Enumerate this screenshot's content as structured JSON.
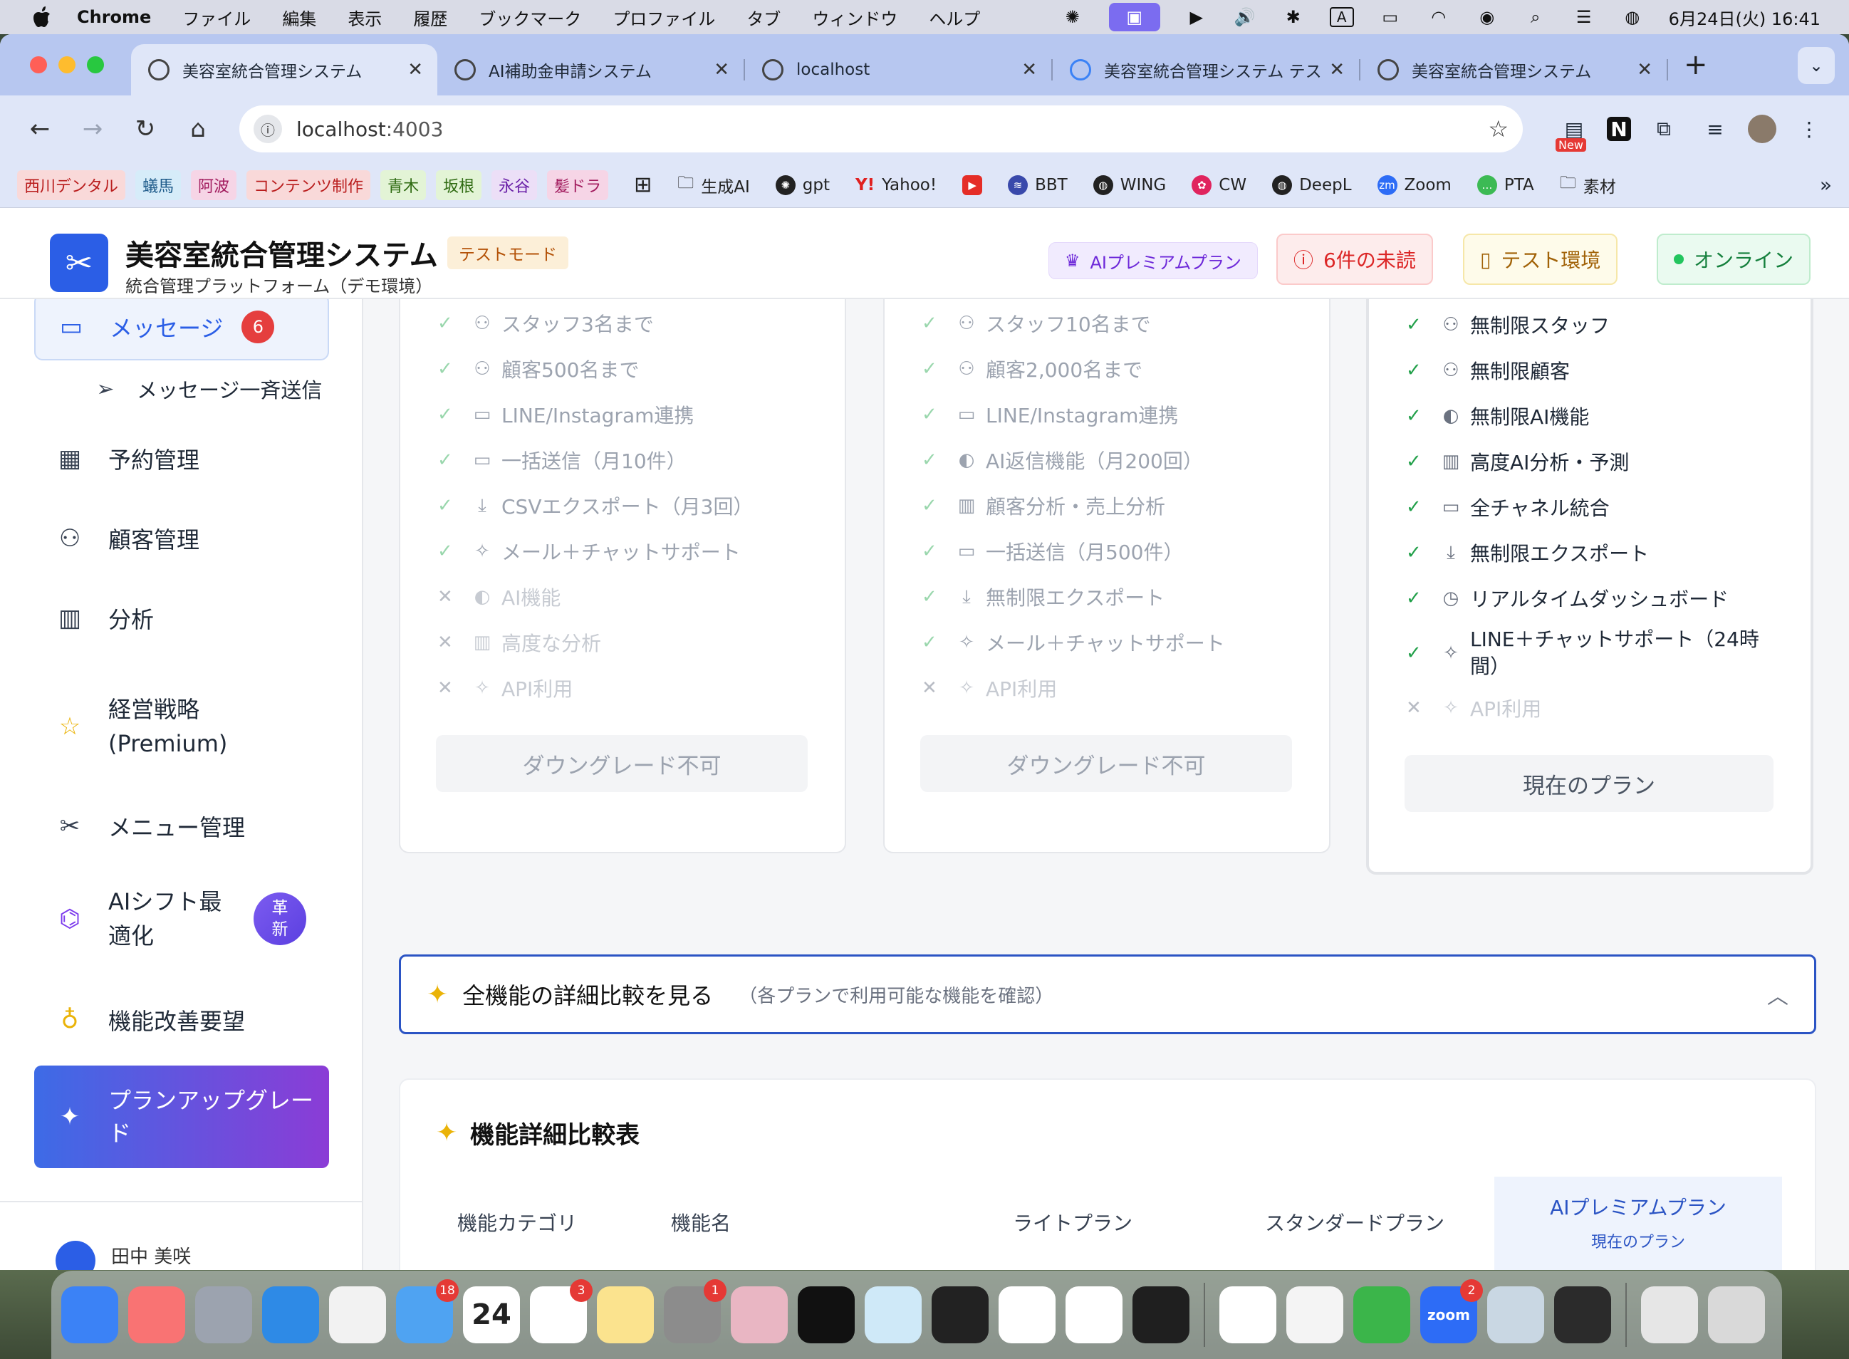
{
  "menubar": {
    "app_name": "Chrome",
    "menus": [
      "ファイル",
      "編集",
      "表示",
      "履歴",
      "ブックマーク",
      "プロファイル",
      "タブ",
      "ウィンドウ",
      "ヘルプ"
    ],
    "clock": "6月24日(火) 16:41",
    "input_indicator": "A"
  },
  "browser": {
    "tabs": [
      {
        "title": "美容室統合管理システム",
        "active": true
      },
      {
        "title": "AI補助金申請システム",
        "active": false
      },
      {
        "title": "localhost",
        "active": false
      },
      {
        "title": "美容室統合管理システム テス",
        "active": false
      },
      {
        "title": "美容室統合管理システム",
        "active": false
      }
    ],
    "url_host": "localhost",
    "url_port": ":4003",
    "bookmark_tags": [
      {
        "label": "西川デンタル",
        "bg": "#f9d9d9",
        "fg": "#b91c1c"
      },
      {
        "label": "蟻馬",
        "bg": "#d6ecf9",
        "fg": "#1e5b8a"
      },
      {
        "label": "阿波",
        "bg": "#f6d5e6",
        "fg": "#a21c5e"
      },
      {
        "label": "コンテンツ制作",
        "bg": "#f9d9d9",
        "fg": "#b91c1c"
      },
      {
        "label": "青木",
        "bg": "#e3f4d6",
        "fg": "#2f6b12"
      },
      {
        "label": "坂根",
        "bg": "#e3f4d6",
        "fg": "#2f6b12"
      },
      {
        "label": "永谷",
        "bg": "#ecdff7",
        "fg": "#6b21a8"
      },
      {
        "label": "髪ドラ",
        "bg": "#f6d5e6",
        "fg": "#a21c5e"
      }
    ],
    "bookmarks": [
      "生成AI",
      "gpt",
      "Yahoo!",
      "BBT",
      "WING",
      "CW",
      "DeepL",
      "Zoom",
      "PTA",
      "素材"
    ],
    "new_label": "New"
  },
  "app": {
    "title": "美容室統合管理システム",
    "subtitle": "統合管理プラットフォーム（デモ環境）",
    "test_mode": "テストモード",
    "header": {
      "premium": "AIプレミアムプラン",
      "unread": "6件の未読",
      "test_env": "テスト環境",
      "online": "オンライン"
    },
    "sidebar": {
      "messages": "メッセージ",
      "messages_count": "6",
      "broadcast": "メッセージ一斉送信",
      "reservations": "予約管理",
      "customers": "顧客管理",
      "analytics": "分析",
      "strategy_line1": "経営戦略",
      "strategy_line2": "(Premium)",
      "menu": "メニュー管理",
      "shift_line1": "AIシフト最",
      "shift_line2": "適化",
      "shift_badge_line1": "革",
      "shift_badge_line2": "新",
      "requests": "機能改善要望",
      "upgrade_line1": "プランアップグレー",
      "upgrade_line2": "ド",
      "user": "田中 美咲"
    },
    "plans": [
      {
        "features": [
          {
            "text": "スタッフ3名まで",
            "ok": true,
            "icon": "users"
          },
          {
            "text": "顧客500名まで",
            "ok": true,
            "icon": "users"
          },
          {
            "text": "LINE/Instagram連携",
            "ok": true,
            "icon": "chat"
          },
          {
            "text": "一括送信（月10件）",
            "ok": true,
            "icon": "chat"
          },
          {
            "text": "CSVエクスポート（月3回）",
            "ok": true,
            "icon": "download"
          },
          {
            "text": "メール＋チャットサポート",
            "ok": true,
            "icon": "sparkle"
          },
          {
            "text": "AI機能",
            "ok": false,
            "icon": "brain"
          },
          {
            "text": "高度な分析",
            "ok": false,
            "icon": "chart"
          },
          {
            "text": "API利用",
            "ok": false,
            "icon": "sparkle"
          }
        ],
        "button": "ダウングレード不可"
      },
      {
        "features": [
          {
            "text": "スタッフ10名まで",
            "ok": true,
            "icon": "users"
          },
          {
            "text": "顧客2,000名まで",
            "ok": true,
            "icon": "users"
          },
          {
            "text": "LINE/Instagram連携",
            "ok": true,
            "icon": "chat"
          },
          {
            "text": "AI返信機能（月200回）",
            "ok": true,
            "icon": "brain"
          },
          {
            "text": "顧客分析・売上分析",
            "ok": true,
            "icon": "chart"
          },
          {
            "text": "一括送信（月500件）",
            "ok": true,
            "icon": "chat"
          },
          {
            "text": "無制限エクスポート",
            "ok": true,
            "icon": "download"
          },
          {
            "text": "メール＋チャットサポート",
            "ok": true,
            "icon": "sparkle"
          },
          {
            "text": "API利用",
            "ok": false,
            "icon": "sparkle"
          }
        ],
        "button": "ダウングレード不可"
      },
      {
        "features": [
          {
            "text": "無制限スタッフ",
            "ok": true,
            "icon": "users"
          },
          {
            "text": "無制限顧客",
            "ok": true,
            "icon": "users"
          },
          {
            "text": "無制限AI機能",
            "ok": true,
            "icon": "brain"
          },
          {
            "text": "高度AI分析・予測",
            "ok": true,
            "icon": "chart"
          },
          {
            "text": "全チャネル統合",
            "ok": true,
            "icon": "chat"
          },
          {
            "text": "無制限エクスポート",
            "ok": true,
            "icon": "download"
          },
          {
            "text": "リアルタイムダッシュボード",
            "ok": true,
            "icon": "clock"
          },
          {
            "text": "LINE＋チャットサポート（24時間）",
            "ok": true,
            "icon": "sparkle"
          },
          {
            "text": "API利用",
            "ok": false,
            "icon": "sparkle"
          }
        ],
        "button": "現在のプラン"
      }
    ],
    "compare_toggle": {
      "title": "全機能の詳細比較を見る",
      "subtitle": "（各プランで利用可能な機能を確認）"
    },
    "compare_table": {
      "title": "機能詳細比較表",
      "col_category": "機能カテゴリ",
      "col_feature": "機能名",
      "col_light": "ライトプラン",
      "col_standard": "スタンダードプラン",
      "col_premium": "AIプレミアムプラン",
      "col_premium_note": "現在のプラン"
    }
  },
  "dock": {
    "apps": [
      {
        "name": "finder",
        "color": "#3b82f6"
      },
      {
        "name": "browser-alt",
        "color": "#f97373"
      },
      {
        "name": "launchpad",
        "color": "#9ca3af"
      },
      {
        "name": "app-store",
        "color": "#2e8ae6"
      },
      {
        "name": "chrome",
        "color": "#f2f2f2"
      },
      {
        "name": "mail",
        "color": "#4fa3f2",
        "badge": "18"
      },
      {
        "name": "calendar",
        "color": "#ffffff",
        "label": "24"
      },
      {
        "name": "reminders",
        "color": "#ffffff",
        "badge": "3"
      },
      {
        "name": "notes",
        "color": "#fbe38e"
      },
      {
        "name": "system-settings",
        "color": "#8c8c8c",
        "badge": "1"
      },
      {
        "name": "iphone-mirroring",
        "color": "#e9b6c3"
      },
      {
        "name": "ai-app",
        "color": "#111111"
      },
      {
        "name": "kindle",
        "color": "#cfe9f8"
      },
      {
        "name": "cube-app",
        "color": "#222222"
      },
      {
        "name": "chatgpt",
        "color": "#ffffff"
      },
      {
        "name": "google-drive",
        "color": "#ffffff"
      },
      {
        "name": "terminal",
        "color": "#1f1f1f"
      },
      {
        "name": "teamviewer",
        "color": "#ffffff"
      },
      {
        "name": "textedit",
        "color": "#f4f4f4"
      },
      {
        "name": "numbers",
        "color": "#3bb54a"
      },
      {
        "name": "zoom",
        "color": "#2d6cf6",
        "badge": "2",
        "label": "zoom"
      },
      {
        "name": "preview",
        "color": "#c9d7e3"
      },
      {
        "name": "final-cut",
        "color": "#2b2b2b"
      },
      {
        "name": "window-preview",
        "color": "#e6e6e6"
      },
      {
        "name": "trash",
        "color": "#d9d9d9"
      }
    ]
  }
}
